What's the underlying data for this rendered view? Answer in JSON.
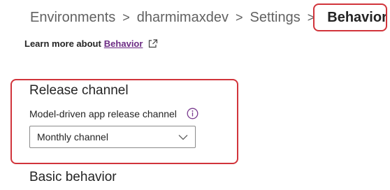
{
  "breadcrumb": {
    "items": [
      "Environments",
      "dharmimaxdev",
      "Settings"
    ],
    "current": "Behavior",
    "separator": ">"
  },
  "learn_more": {
    "prefix": "Learn more about",
    "link_text": "Behavior",
    "icon": "open-in-new-window-icon"
  },
  "release_channel": {
    "title": "Release channel",
    "field_label": "Model-driven app release channel",
    "info_icon": "info-icon",
    "selected": "Monthly channel",
    "dropdown_icon": "chevron-down-icon"
  },
  "basic_behavior": {
    "title": "Basic behavior"
  },
  "colors": {
    "highlight": "#d1343b",
    "link": "#6b2a83",
    "text": "#242424",
    "muted": "#616161"
  }
}
